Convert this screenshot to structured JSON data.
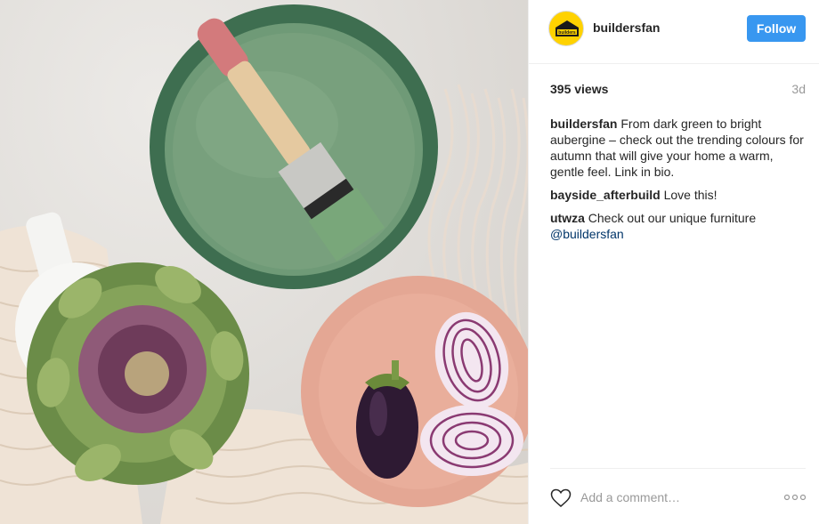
{
  "post": {
    "username": "buildersfan",
    "avatar_text": "builders",
    "follow_label": "Follow",
    "views": "395 views",
    "age": "3d"
  },
  "comments": [
    {
      "user": "buildersfan",
      "text": "From dark green to bright aubergine – check out the trending colours for autumn that will give your home a warm, gentle feel. Link in bio.",
      "mention": ""
    },
    {
      "user": "bayside_afterbuild",
      "text": "Love this!",
      "mention": ""
    },
    {
      "user": "utwza",
      "text": "Check out our unique furniture",
      "mention": "@buildersfan"
    }
  ],
  "footer": {
    "add_comment_placeholder": "Add a comment…"
  },
  "colors": {
    "follow_bg": "#3897f0",
    "avatar_bg": "#ffd200",
    "mention": "#003569"
  },
  "icons": [
    "heart-icon",
    "more-options-icon",
    "builders-logo-icon"
  ]
}
